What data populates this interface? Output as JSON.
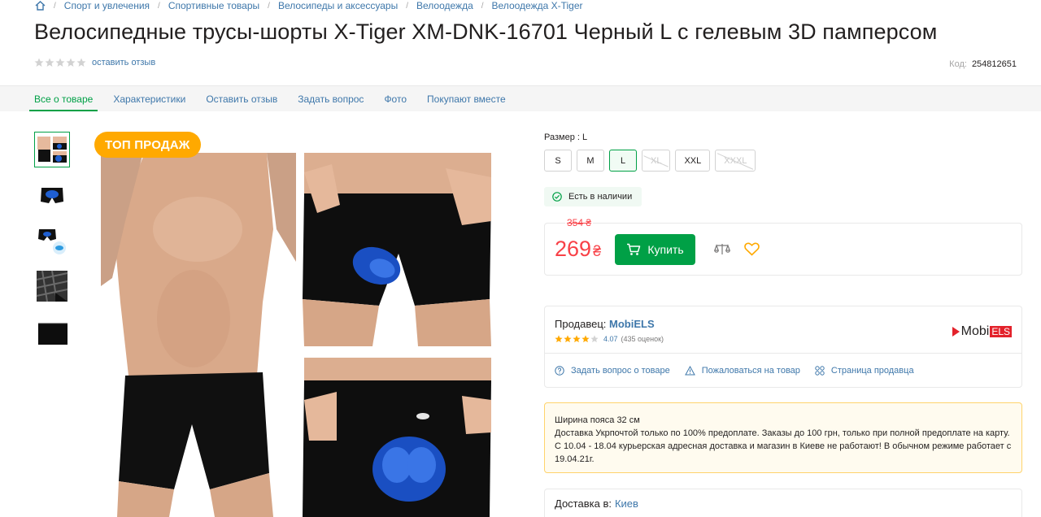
{
  "breadcrumb": {
    "items": [
      "Спорт и увлечения",
      "Спортивные товары",
      "Велосипеды и аксессуары",
      "Велоодежда",
      "Велоодежда X-Tiger"
    ]
  },
  "product": {
    "title": "Велосипедные трусы-шорты X-Tiger XM-DNK-16701 Черный L с гелевым 3D памперсом",
    "review_link": "оставить отзыв",
    "code_label": "Код:",
    "code_value": "254812651",
    "badge": "ТОП ПРОДАЖ"
  },
  "tabs": [
    "Все о товаре",
    "Характеристики",
    "Оставить отзыв",
    "Задать вопрос",
    "Фото",
    "Покупают вместе"
  ],
  "sizes": {
    "label": "Размер : L",
    "options": [
      {
        "label": "S",
        "state": "available"
      },
      {
        "label": "M",
        "state": "available"
      },
      {
        "label": "L",
        "state": "selected"
      },
      {
        "label": "XL",
        "state": "unavailable"
      },
      {
        "label": "XXL",
        "state": "available"
      },
      {
        "label": "XXXL",
        "state": "unavailable"
      }
    ]
  },
  "stock": "Есть в наличии",
  "buy": {
    "old_price": "354 ₴",
    "price": "269",
    "currency": "₴",
    "button": "Купить"
  },
  "seller": {
    "label": "Продавец:",
    "name": "MobiELS",
    "rating": "4.07",
    "reviews": "(435 оценок)",
    "logo_text": "Mobi",
    "logo_badge": "ELS",
    "actions": [
      "Задать вопрос о товаре",
      "Пожаловаться на товар",
      "Страница продавца"
    ]
  },
  "notice": {
    "lines": [
      "Ширина пояса 32 см",
      "Доставка Укрпочтой только по 100% предоплате. Заказы до 100 грн, только при полной предоплате на карту. С 10.04 - 18.04 курьерская адресная доставка и магазин в Киеве не работают! В обычном режиме работает с 19.04.21г."
    ]
  },
  "delivery": {
    "label": "Доставка в:",
    "city": "Киев"
  },
  "colors": {
    "accent_green": "#00a046",
    "link_blue": "#3e77aa",
    "price_red": "#f84147",
    "badge_orange": "#ffa900",
    "star_gold": "#ffa900"
  }
}
